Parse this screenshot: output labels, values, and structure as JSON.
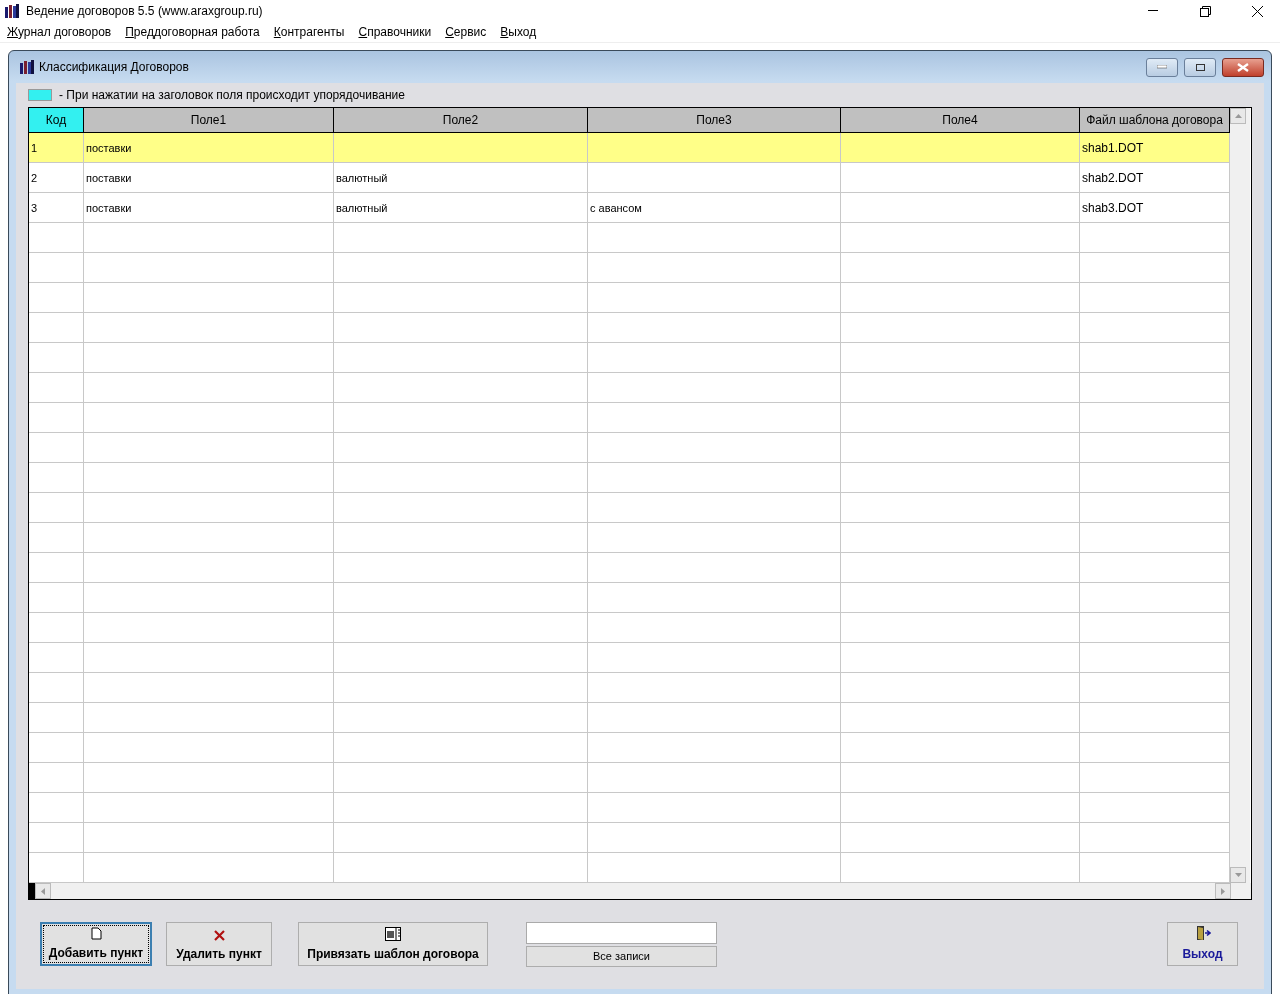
{
  "window": {
    "title": "Ведение договоров 5.5 (www.araxgroup.ru)"
  },
  "menu": [
    "Журнал договоров",
    "Преддоговорная работа",
    "Контрагенты",
    "Справочники",
    "Сервис",
    "Выход"
  ],
  "child_window": {
    "title": "Классификация Договоров",
    "legend": {
      "color": "#33f0f0",
      "text": "- При нажатии на заголовок поля  происходит упорядочивание"
    },
    "table": {
      "columns": [
        {
          "label": "Код",
          "sortable": true
        },
        {
          "label": "Поле1",
          "sortable": false
        },
        {
          "label": "Поле2",
          "sortable": false
        },
        {
          "label": "Поле3",
          "sortable": false
        },
        {
          "label": "Поле4",
          "sortable": false
        },
        {
          "label": "Файл шаблона договора",
          "sortable": false
        }
      ],
      "rows": [
        {
          "selected": true,
          "cells": [
            "1",
            "поставки",
            "",
            "",
            "",
            "shab1.DOT"
          ]
        },
        {
          "selected": false,
          "cells": [
            "2",
            "поставки",
            "валютный",
            "",
            "",
            "shab2.DOT"
          ]
        },
        {
          "selected": false,
          "cells": [
            "3",
            "поставки",
            "валютный",
            "с авансом",
            "",
            "shab3.DOT"
          ]
        }
      ]
    },
    "buttons": [
      {
        "kind": "add",
        "label": "Добавить пункт",
        "focused": true
      },
      {
        "kind": "delete",
        "label": "Удалить пункт",
        "focused": false
      },
      {
        "kind": "template",
        "label": "Привязать шаблон договора",
        "focused": false
      }
    ],
    "filter_button": "Все записи",
    "exit_button": "Выход"
  }
}
